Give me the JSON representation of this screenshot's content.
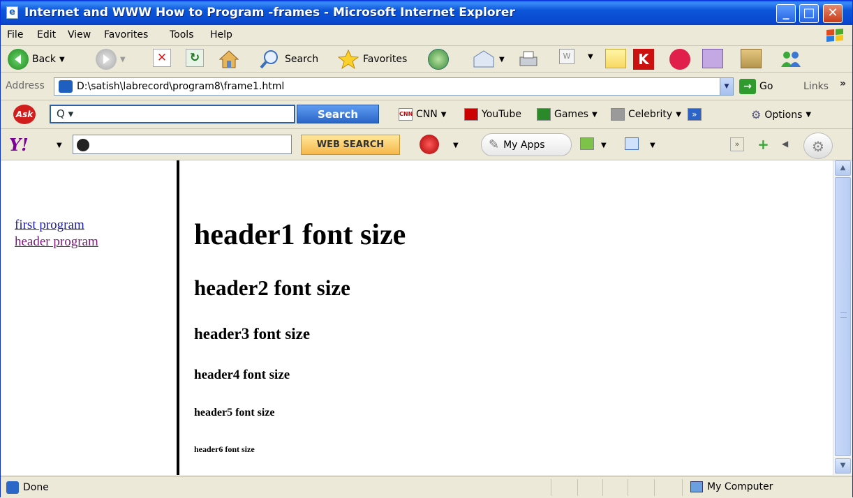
{
  "window": {
    "title": "Internet and WWW How to Program -frames - Microsoft Internet Explorer",
    "icon": "ie-page-icon"
  },
  "menu": [
    "File",
    "Edit",
    "View",
    "Favorites",
    "Tools",
    "Help"
  ],
  "toolbar": {
    "back_label": "Back",
    "search_label": "Search",
    "favorites_label": "Favorites"
  },
  "address": {
    "label": "Address",
    "value": "D:\\satish\\labrecord\\program8\\frame1.html",
    "go_label": "Go",
    "links_label": "Links"
  },
  "ask_toolbar": {
    "logo": "Ask",
    "search_button": "Search",
    "items": [
      "CNN",
      "YouTube",
      "Games",
      "Celebrity"
    ],
    "options_label": "Options"
  },
  "yahoo_toolbar": {
    "logo": "Y!",
    "search_button": "WEB SEARCH",
    "myapps_label": "My Apps"
  },
  "left_frame": {
    "links": [
      {
        "text": "first program"
      },
      {
        "text": "header program"
      }
    ]
  },
  "right_frame": {
    "headings": [
      "header1 font size",
      "header2 font size",
      "header3 font size",
      "header4 font size",
      "header5 font size",
      "header6 font size"
    ]
  },
  "status": {
    "text": "Done",
    "zone": "My Computer"
  }
}
